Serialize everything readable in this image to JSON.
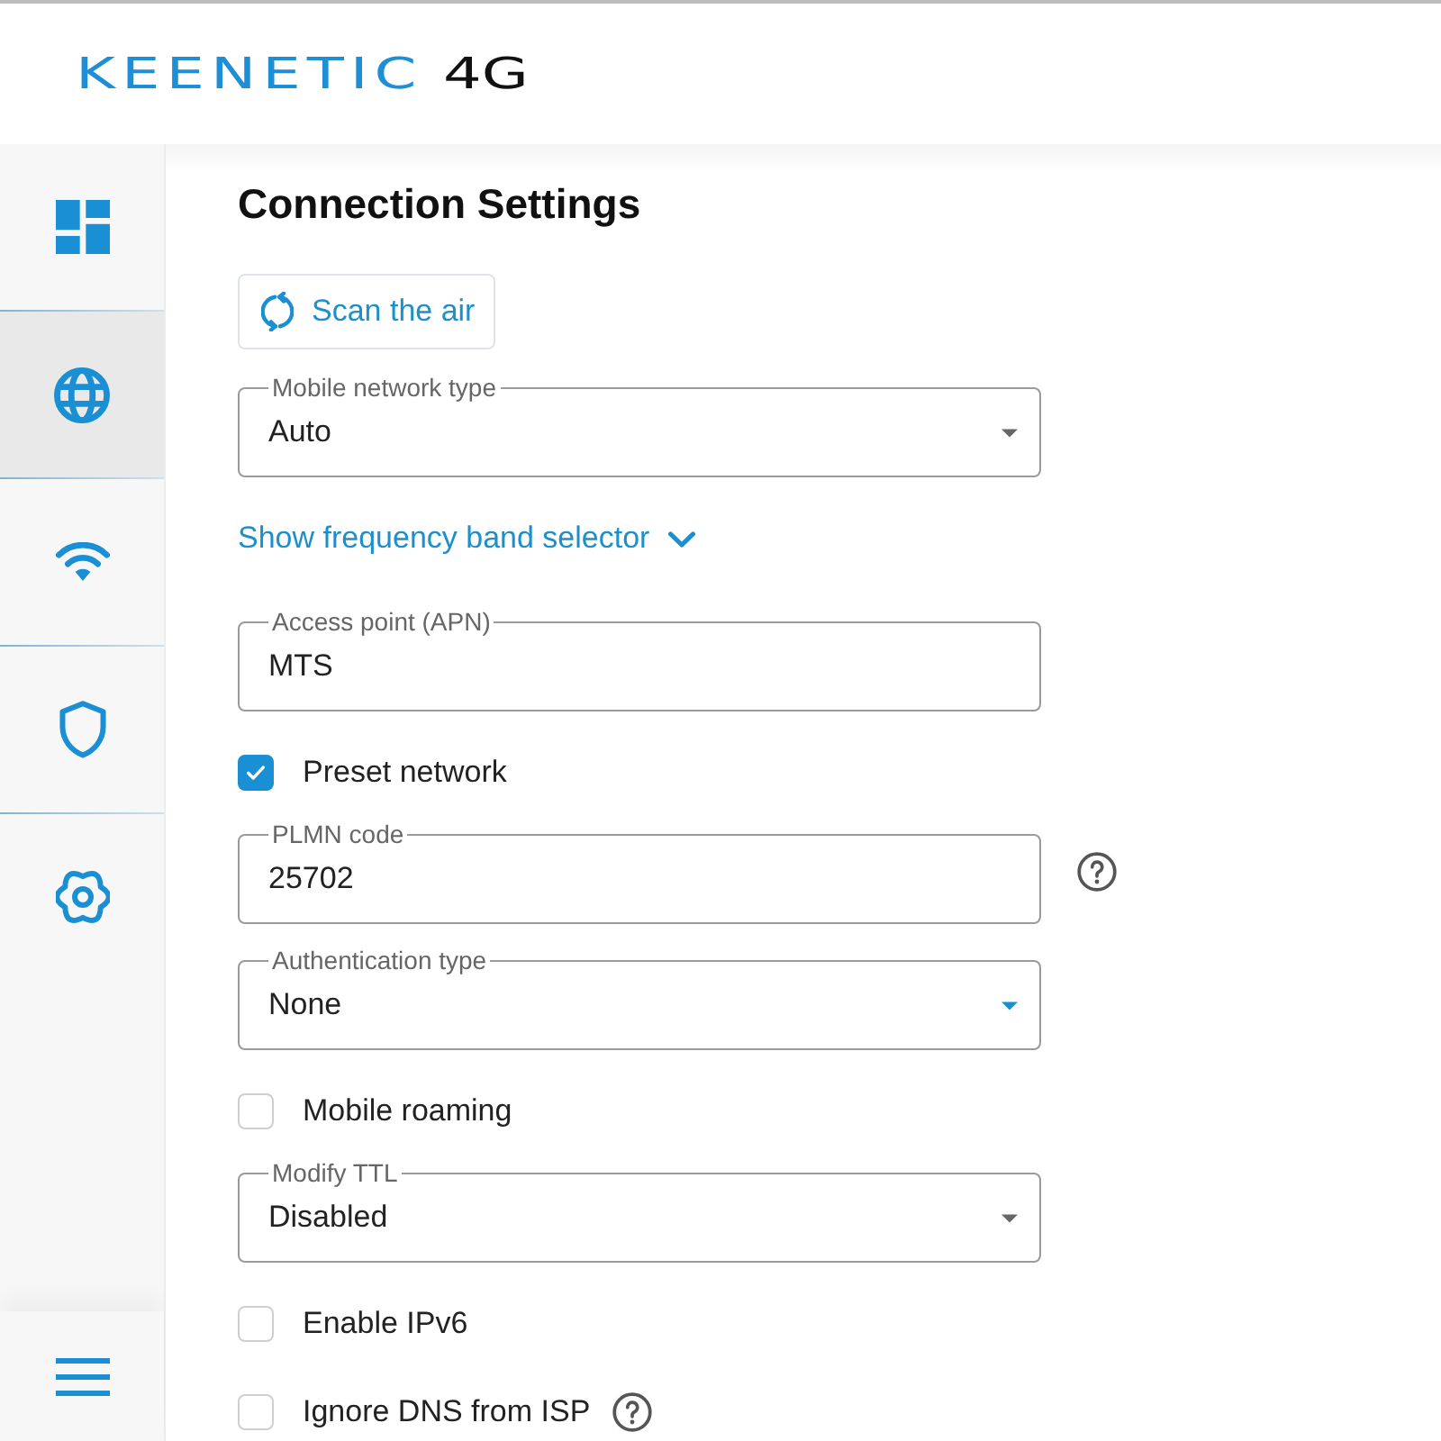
{
  "header": {
    "brand": "KEENETIC",
    "model": "4G"
  },
  "sidebar": {
    "items": [
      {
        "selected": false
      },
      {
        "selected": true
      },
      {
        "selected": false
      },
      {
        "selected": false
      },
      {
        "selected": false
      }
    ]
  },
  "main": {
    "title": "Connection Settings",
    "fields": [
      {
        "kind": "button",
        "label": "Scan the air"
      },
      {
        "kind": "select",
        "label": "Mobile network type",
        "value": "Auto",
        "focused": false,
        "help": false
      },
      {
        "kind": "link",
        "label": "Show frequency band selector",
        "expanded": false
      },
      {
        "kind": "input",
        "label": "Access point (APN)",
        "value": "MTS",
        "help": false
      },
      {
        "kind": "checkbox",
        "label": "Preset network",
        "checked": true,
        "help": false
      },
      {
        "kind": "input",
        "label": "PLMN code",
        "value": "25702",
        "help": true
      },
      {
        "kind": "select",
        "label": "Authentication type",
        "value": "None",
        "focused": true,
        "help": false
      },
      {
        "kind": "checkbox",
        "label": "Mobile roaming",
        "checked": false,
        "help": false
      },
      {
        "kind": "select",
        "label": "Modify TTL",
        "value": "Disabled",
        "focused": false,
        "help": false
      },
      {
        "kind": "checkbox",
        "label": "Enable IPv6",
        "checked": false,
        "help": false
      },
      {
        "kind": "checkbox",
        "label": "Ignore DNS from ISP",
        "checked": false,
        "help": true
      }
    ]
  }
}
